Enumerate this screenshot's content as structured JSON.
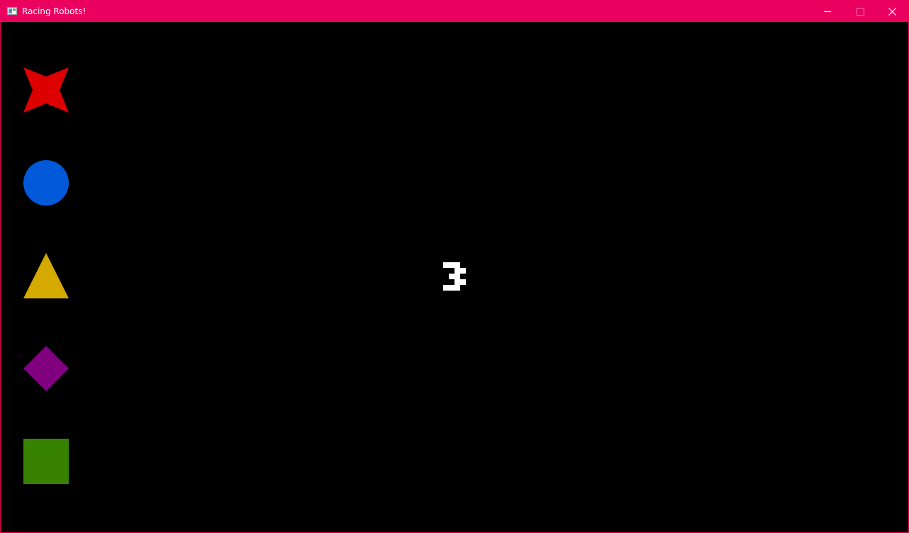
{
  "window": {
    "title": "Racing Robots!",
    "titlebar_color": "#ea005e",
    "controls": [
      "minimize-icon",
      "maximize-icon",
      "close-icon"
    ]
  },
  "game": {
    "background": "#000000",
    "countdown": "3",
    "robots": [
      {
        "shape": "star-icon",
        "color": "#dd0000"
      },
      {
        "shape": "circle-icon",
        "color": "#0059d9"
      },
      {
        "shape": "triangle-icon",
        "color": "#d4aa00"
      },
      {
        "shape": "diamond-icon",
        "color": "#800080"
      },
      {
        "shape": "square-icon",
        "color": "#378200"
      }
    ]
  }
}
